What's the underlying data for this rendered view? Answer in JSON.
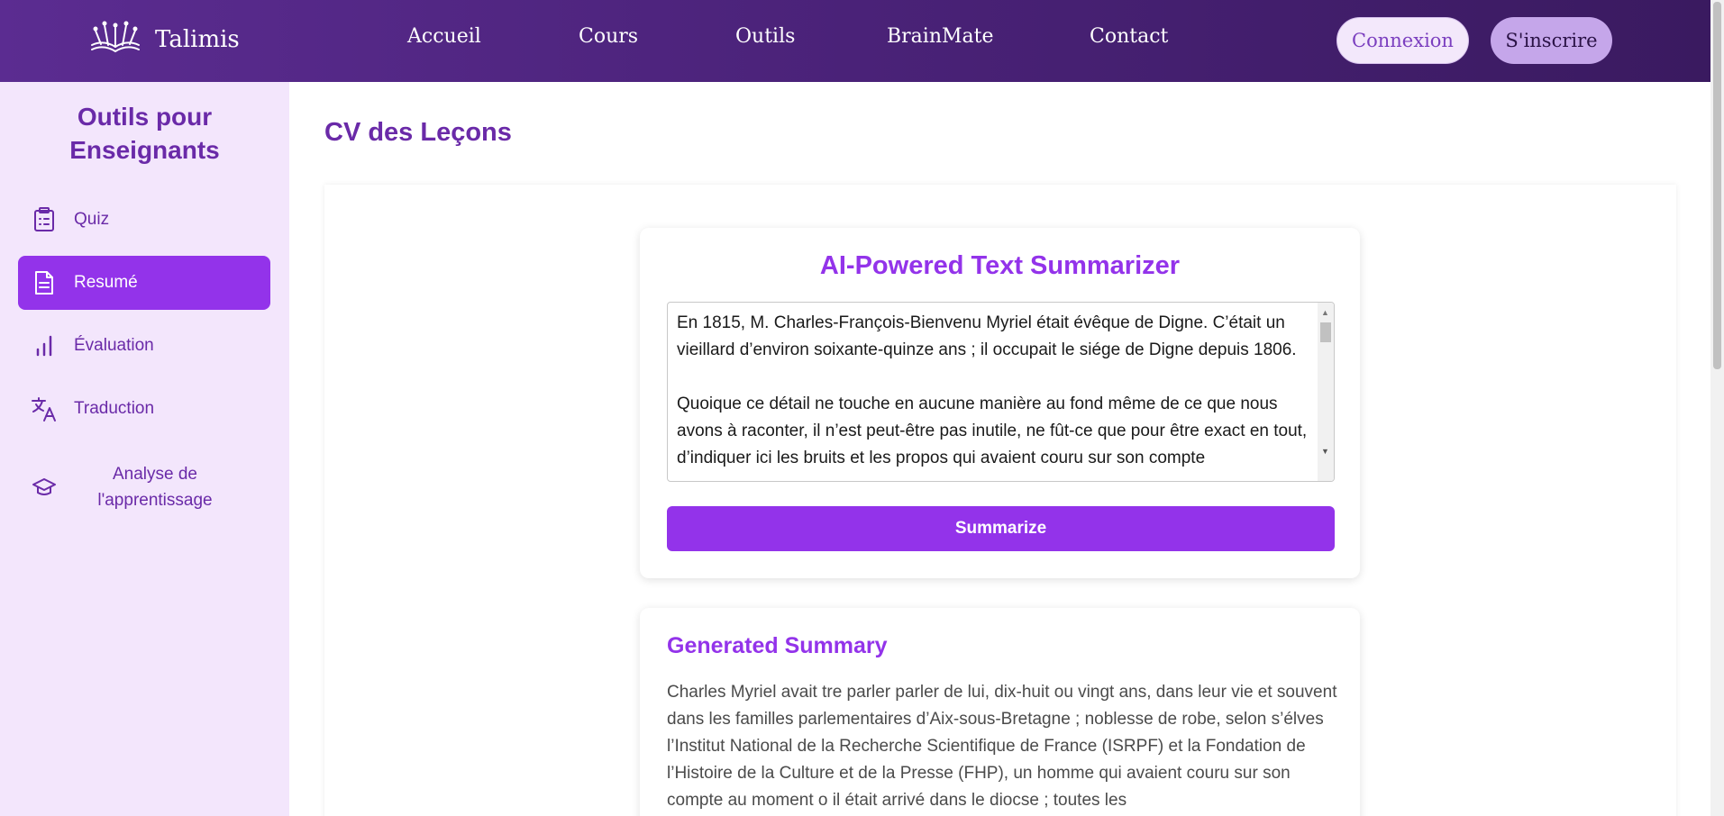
{
  "header": {
    "brand_name": "Talimis",
    "nav": [
      "Accueil",
      "Cours",
      "Outils",
      "BrainMate",
      "Contact"
    ],
    "login_label": "Connexion",
    "signup_label": "S'inscrire"
  },
  "sidebar": {
    "title": "Outils pour Enseignants",
    "items": [
      {
        "label": "Quiz",
        "icon": "clipboard-list-icon"
      },
      {
        "label": "Resumé",
        "icon": "document-icon",
        "active": true
      },
      {
        "label": "Évaluation",
        "icon": "bar-chart-icon"
      },
      {
        "label": "Traduction",
        "icon": "translate-icon"
      },
      {
        "label": "Analyse de l'apprentissage",
        "icon": "graduation-cap-icon"
      }
    ]
  },
  "main": {
    "page_title": "CV des Leçons",
    "summarizer": {
      "title": "AI-Powered Text Summarizer",
      "input_text": "En 1815, M. Charles-François-Bienvenu Myriel était évêque de Digne. C’était un vieillard d’environ soixante-quinze ans ; il occupait le siége de Digne depuis 1806.\n\nQuoique ce détail ne touche en aucune manière au fond même de ce que nous avons à raconter, il n’est peut-être pas inutile, ne fût-ce que pour être exact en tout, d’indiquer ici les bruits et les propos qui avaient couru sur son compte",
      "button_label": "Summarize"
    },
    "summary": {
      "title": "Generated Summary",
      "text": "Charles Myriel avait tre parler parler de lui, dix-huit ou vingt ans, dans leur vie et souvent dans les familles parlementaires d’Aix-sous-Bretagne ; noblesse de robe, selon s’élves l’Institut National de la Recherche Scientifique de France (ISRPF) et la Fondation de l’Histoire de la Culture et de la Presse (FHP), un homme qui avaient couru sur son compte au moment o il était arrivé dans le diocse ; toutes les"
    }
  },
  "colors": {
    "accent": "#9333ea",
    "sidebar_bg": "#f3e6fc",
    "heading": "#6a2aa8"
  }
}
